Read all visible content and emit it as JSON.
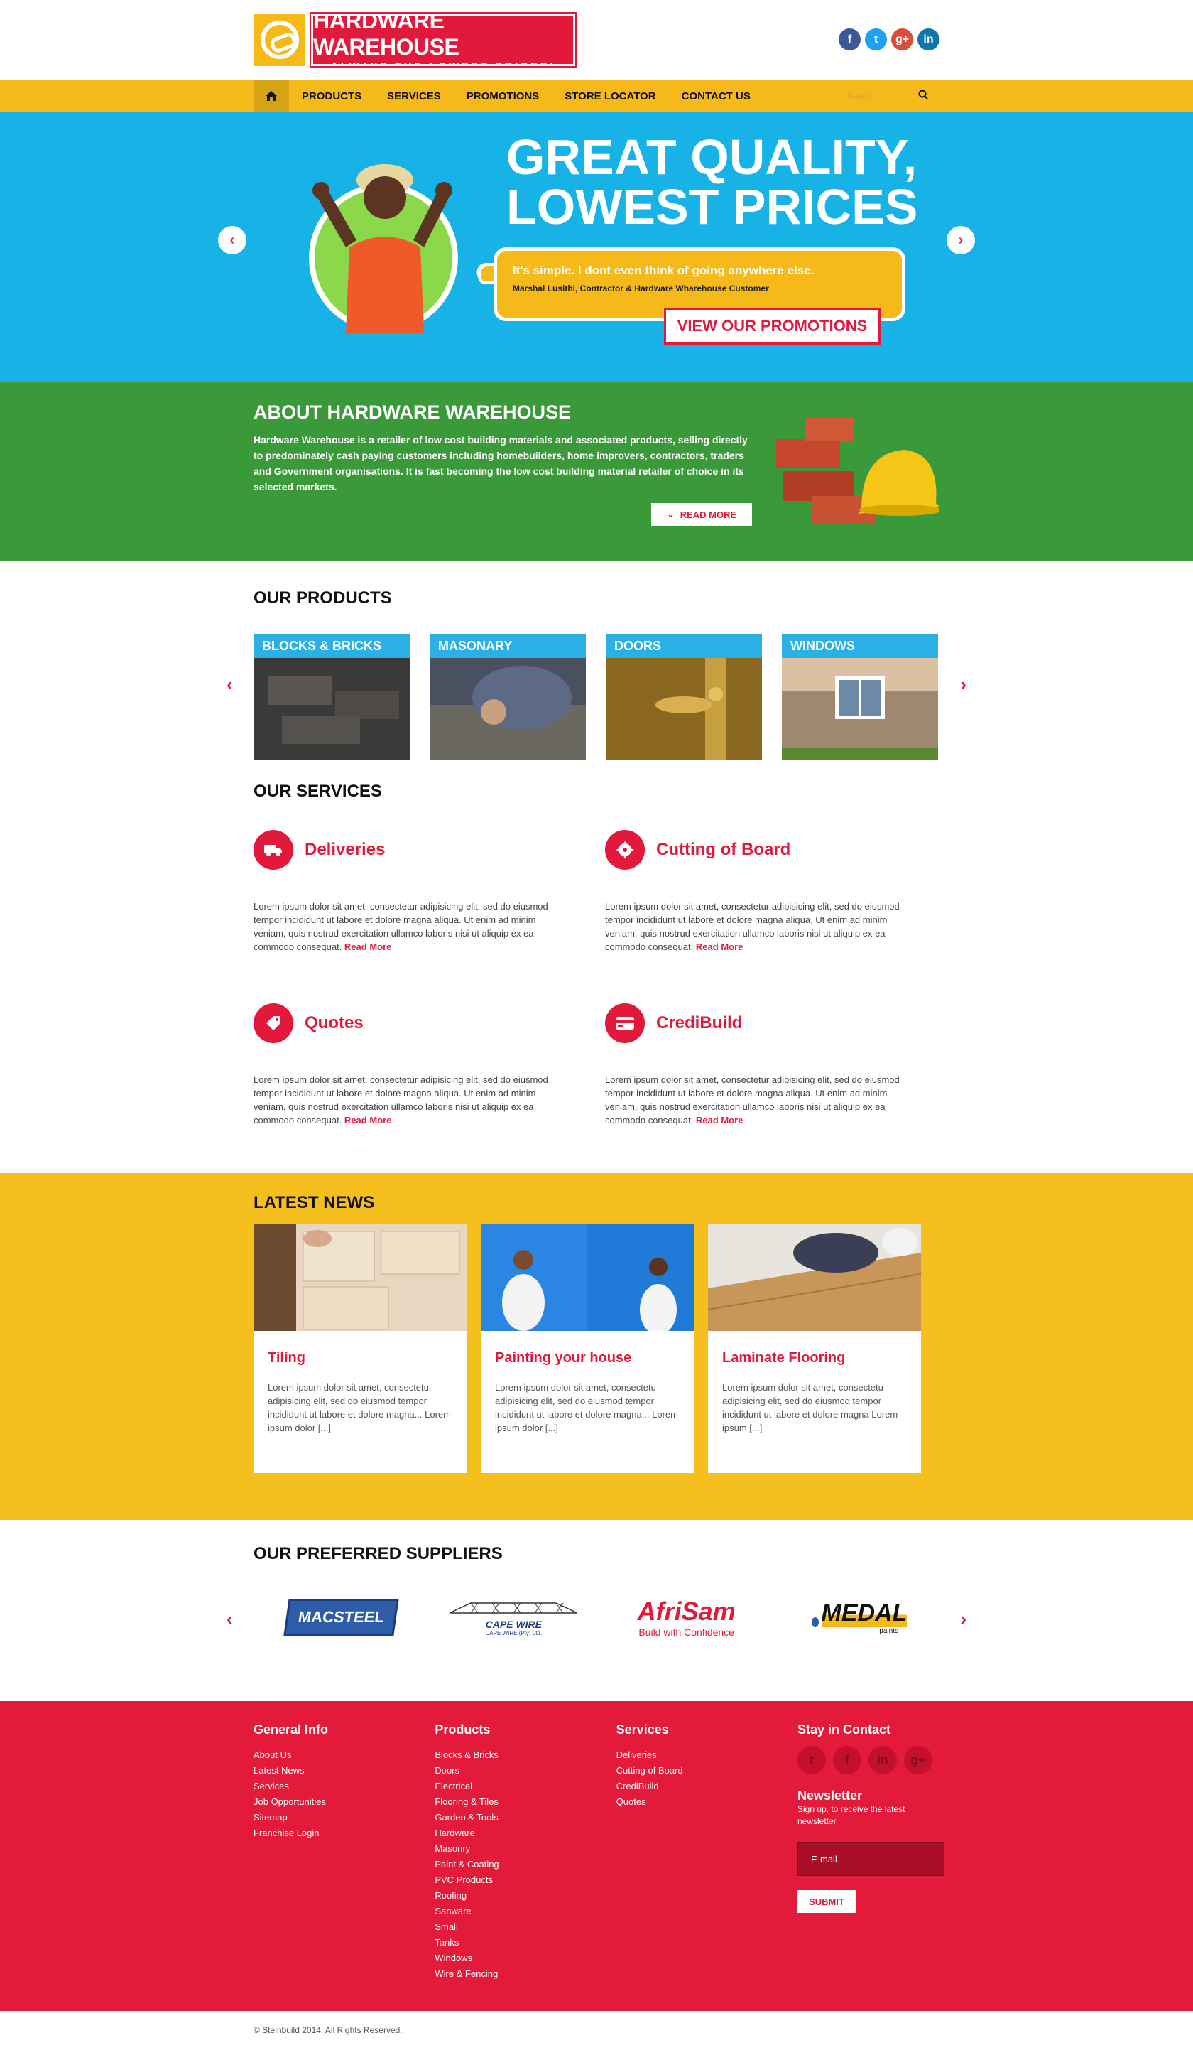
{
  "header": {
    "logo_title": "HARDWARE WAREHOUSE",
    "logo_sub": "ALWAYS THE LOWEST PRICES!",
    "social": [
      {
        "icon": "facebook-icon",
        "glyph": "f",
        "color": "#3b5998"
      },
      {
        "icon": "twitter-icon",
        "glyph": "t",
        "color": "#1da1f2"
      },
      {
        "icon": "google-plus-icon",
        "glyph": "g+",
        "color": "#dd4b39"
      },
      {
        "icon": "linkedin-icon",
        "glyph": "in",
        "color": "#0e76a8"
      }
    ]
  },
  "nav": {
    "items": [
      "PRODUCTS",
      "SERVICES",
      "PROMOTIONS",
      "STORE LOCATOR",
      "CONTACT US"
    ],
    "search_placeholder": "Search"
  },
  "hero": {
    "title_line1": "GREAT QUALITY,",
    "title_line2": "LOWEST PRICES",
    "quote": "It's simple. I dont even think of going anywhere else.",
    "quote_by": "Marshal Lusithi, Contractor & Hardware Wharehouse Customer",
    "button": "VIEW OUR PROMOTIONS"
  },
  "about": {
    "title": "ABOUT HARDWARE WAREHOUSE",
    "text": "Hardware Warehouse is a retailer of low cost building materials and associated products, selling directly to predominately cash paying customers including homebuilders, home improvers, contractors, traders and Government organisations. It is fast becoming the low cost building material retailer of choice in its selected markets.",
    "button": "READ MORE"
  },
  "products": {
    "title": "OUR PRODUCTS",
    "items": [
      "BLOCKS & BRICKS",
      "MASONARY",
      "DOORS",
      "WINDOWS"
    ]
  },
  "services": {
    "title": "OUR SERVICES",
    "lorem": "Lorem ipsum dolor sit amet, consectetur adipisicing elit, sed do eiusmod tempor incididunt ut labore et dolore magna aliqua. Ut enim ad minim veniam, quis nostrud exercitation ullamco laboris nisi ut aliquip ex ea commodo consequat.",
    "read_more": "Read More",
    "items": [
      {
        "title": "Deliveries",
        "icon": "truck-icon"
      },
      {
        "title": "Cutting of Board",
        "icon": "saw-blade-icon"
      },
      {
        "title": "Quotes",
        "icon": "price-tag-icon"
      },
      {
        "title": "CrediBuild",
        "icon": "credit-card-icon"
      }
    ]
  },
  "news": {
    "title": "LATEST NEWS",
    "items": [
      {
        "title": "Tiling",
        "text": "Lorem ipsum dolor sit amet, consectetu adipisicing elit, sed do eiusmod tempor incididunt ut labore et dolore magna... Lorem ipsum dolor [...]"
      },
      {
        "title": "Painting your house",
        "text": "Lorem ipsum dolor sit amet, consectetu adipisicing elit, sed do eiusmod tempor incididunt ut labore et dolore magna... Lorem ipsum dolor [...]"
      },
      {
        "title": "Laminate Flooring",
        "text": "Lorem ipsum dolor sit amet, consectetu adipisicing elit, sed do eiusmod tempor incididunt ut labore et dolore magna Lorem ipsum [...]"
      }
    ]
  },
  "suppliers": {
    "title": "OUR PREFERRED SUPPLIERS",
    "macsteel": "MACSTEEL",
    "capewire": "CAPE WIRE",
    "capewire_sub": "CAPE WIRE (Pty) Ltd.",
    "afrisam": "AfriSam",
    "afrisam_tag": "Build with Confidence",
    "medal": "MEDAL",
    "medal_sub": "paints"
  },
  "footer": {
    "general": {
      "title": "General Info",
      "links": [
        "About Us",
        "Latest News",
        "Services",
        "Job Opportunities",
        "Sitemap",
        "Franchise Login"
      ]
    },
    "products": {
      "title": "Products",
      "links": [
        "Blocks & Bricks",
        "Doors",
        "Electrical",
        "Flooring & Tiles",
        "Garden & Tools",
        "Hardware",
        "Masonry",
        "Paint & Coating",
        "PVC Products",
        "Roofing",
        "Sanware",
        "Small",
        "Tanks",
        "Windows",
        "Wire & Fencing"
      ]
    },
    "services": {
      "title": "Services",
      "links": [
        "Deliveries",
        "Cutting of Board",
        "CrediBuild",
        "Quotes"
      ]
    },
    "contact": {
      "title": "Stay in Contact",
      "social": [
        "twitter-icon",
        "facebook-icon",
        "linkedin-icon",
        "google-plus-icon"
      ],
      "newsletter_title": "Newsletter",
      "newsletter_sub": "Sign up, to receive the latest newsletter",
      "email_placeholder": "E-mail",
      "submit": "SUBMIT"
    },
    "copyright": "© Steinbuild 2014. All Rights Reserved."
  },
  "colors": {
    "brand_red": "#e2193b",
    "brand_yellow": "#f5b91a",
    "hero_blue": "#17b3e6",
    "about_green": "#3a9a3a"
  }
}
